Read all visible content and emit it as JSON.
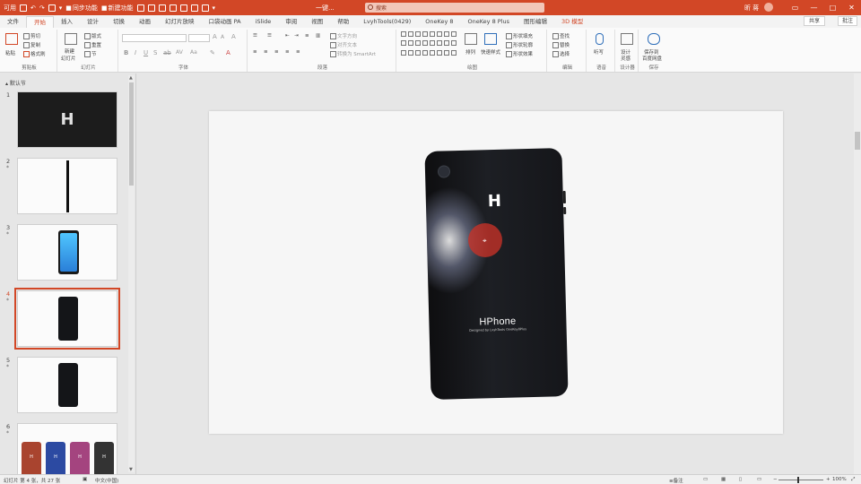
{
  "titlebar": {
    "qat_items": [
      "可用",
      "新建",
      "撤消",
      "重做",
      "放映",
      "另存",
      "保存"
    ],
    "buttons": [
      "同步功能",
      "新建功能"
    ],
    "doc_title": "一键...",
    "search_placeholder": "搜索",
    "user": "昕 蒋",
    "window_controls": [
      "▭",
      "—",
      "□",
      "✕"
    ]
  },
  "tabs": {
    "items": [
      "文件",
      "开始",
      "插入",
      "设计",
      "切换",
      "动画",
      "幻灯片放映",
      "口袋动画 PA",
      "iSlide",
      "审阅",
      "视图",
      "帮助",
      "LvyhTools(0429)",
      "OneKey 8",
      "OneKey 8 Plus",
      "图形编辑",
      "3D 模型"
    ],
    "active": "开始",
    "share": "共享",
    "comment": "批注"
  },
  "ribbon": {
    "clipboard": {
      "paste": "粘贴",
      "cut": "剪切",
      "copy": "复制",
      "format_painter": "格式刷",
      "label": "剪贴板"
    },
    "slides": {
      "new_slide": "新建",
      "new_slide2": "幻灯片",
      "layout": "版式",
      "reset": "重置",
      "section": "节",
      "label": "幻灯片"
    },
    "font": {
      "label": "字体"
    },
    "paragraph": {
      "text_direction": "文字方向",
      "align_text": "对齐文本",
      "smartart": "转换为 SmartArt",
      "label": "段落"
    },
    "drawing": {
      "arrange": "排列",
      "quick_styles": "快速样式",
      "shape_fill": "形状填充",
      "shape_outline": "形状轮廓",
      "shape_effects": "形状效果",
      "label": "绘图"
    },
    "editing": {
      "find": "查找",
      "replace": "替换",
      "select": "选择",
      "label": "编辑"
    },
    "voice": {
      "dictate": "听写",
      "label": "语音"
    },
    "designer": {
      "design_ideas": "设计",
      "design_ideas2": "灵感",
      "label": "设计器"
    },
    "save": {
      "save_to": "保存到",
      "save_to2": "百度网盘",
      "label": "保存"
    }
  },
  "left_panel": {
    "section": "默认节",
    "slides": [
      {
        "num": "1",
        "star": "",
        "logo": "H",
        "active": false
      },
      {
        "num": "2",
        "star": "*",
        "active": false
      },
      {
        "num": "3",
        "star": "*",
        "active": false
      },
      {
        "num": "4",
        "star": "*",
        "active": true
      },
      {
        "num": "5",
        "star": "*",
        "active": false
      },
      {
        "num": "6",
        "star": "*",
        "active": false
      }
    ],
    "slide6_logos": [
      "H",
      "H",
      "H",
      "H"
    ]
  },
  "slide": {
    "logo": "H",
    "brand": "HPhone",
    "tagline": "Designed by LvyhTools OneKey8Plus"
  },
  "statusbar": {
    "slide_info": "幻灯片 第 4 张，共 27 张",
    "language": "中文(中国)",
    "notes": "备注",
    "zoom": "100%"
  }
}
